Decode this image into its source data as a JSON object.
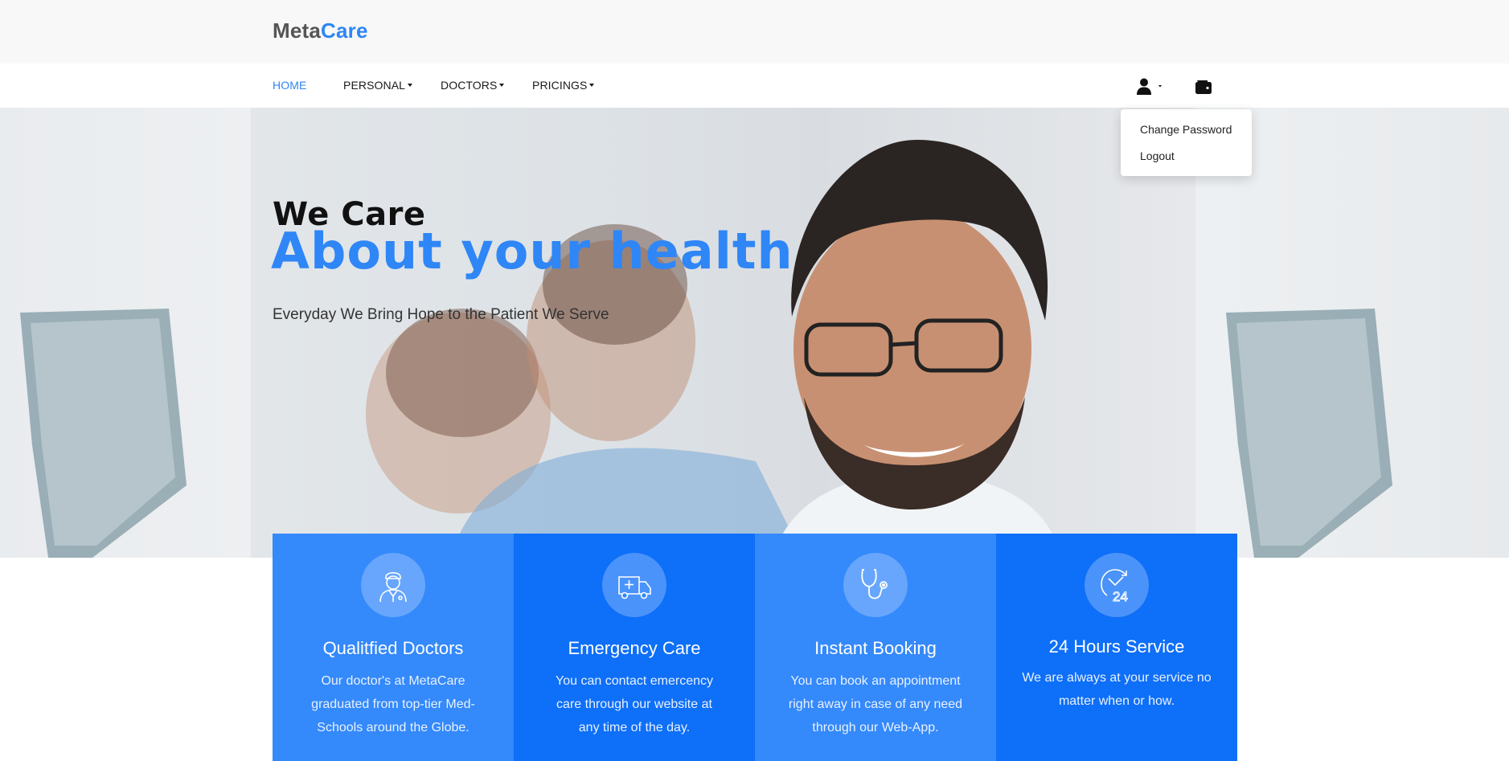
{
  "brand": {
    "part1": "Meta",
    "part2": "Care"
  },
  "nav": {
    "items": [
      {
        "label": "HOME",
        "active": true
      },
      {
        "label": "PERSONAL",
        "dropdown": true
      },
      {
        "label": "DOCTORS",
        "dropdown": true
      },
      {
        "label": "PRICINGS",
        "dropdown": true
      }
    ],
    "user_icon": "user-icon",
    "wallet_icon": "wallet-icon"
  },
  "user_menu": {
    "items": [
      "Change Password",
      "Logout"
    ]
  },
  "hero": {
    "line1": "We Care",
    "line2": "About your health",
    "subtitle": "Everyday We Bring Hope to the Patient We Serve"
  },
  "features": [
    {
      "icon": "doctor-icon",
      "title": "Qualitfied Doctors",
      "text": "Our doctor's at MetaCare graduated from top-tier Med-Schools around the Globe."
    },
    {
      "icon": "ambulance-icon",
      "title": "Emergency Care",
      "text": "You can contact emercency care through our website at any time of the day."
    },
    {
      "icon": "stethoscope-icon",
      "title": "Instant Booking",
      "text": "You can book an appointment right away in case of any need through our Web-App."
    },
    {
      "icon": "clock-24-icon",
      "title": "24 Hours Service",
      "text": "We are always at your service no matter when or how."
    }
  ],
  "colors": {
    "accent": "#2f86f6",
    "card_light": "#3489fb",
    "card_dark": "#0e6ff8"
  }
}
